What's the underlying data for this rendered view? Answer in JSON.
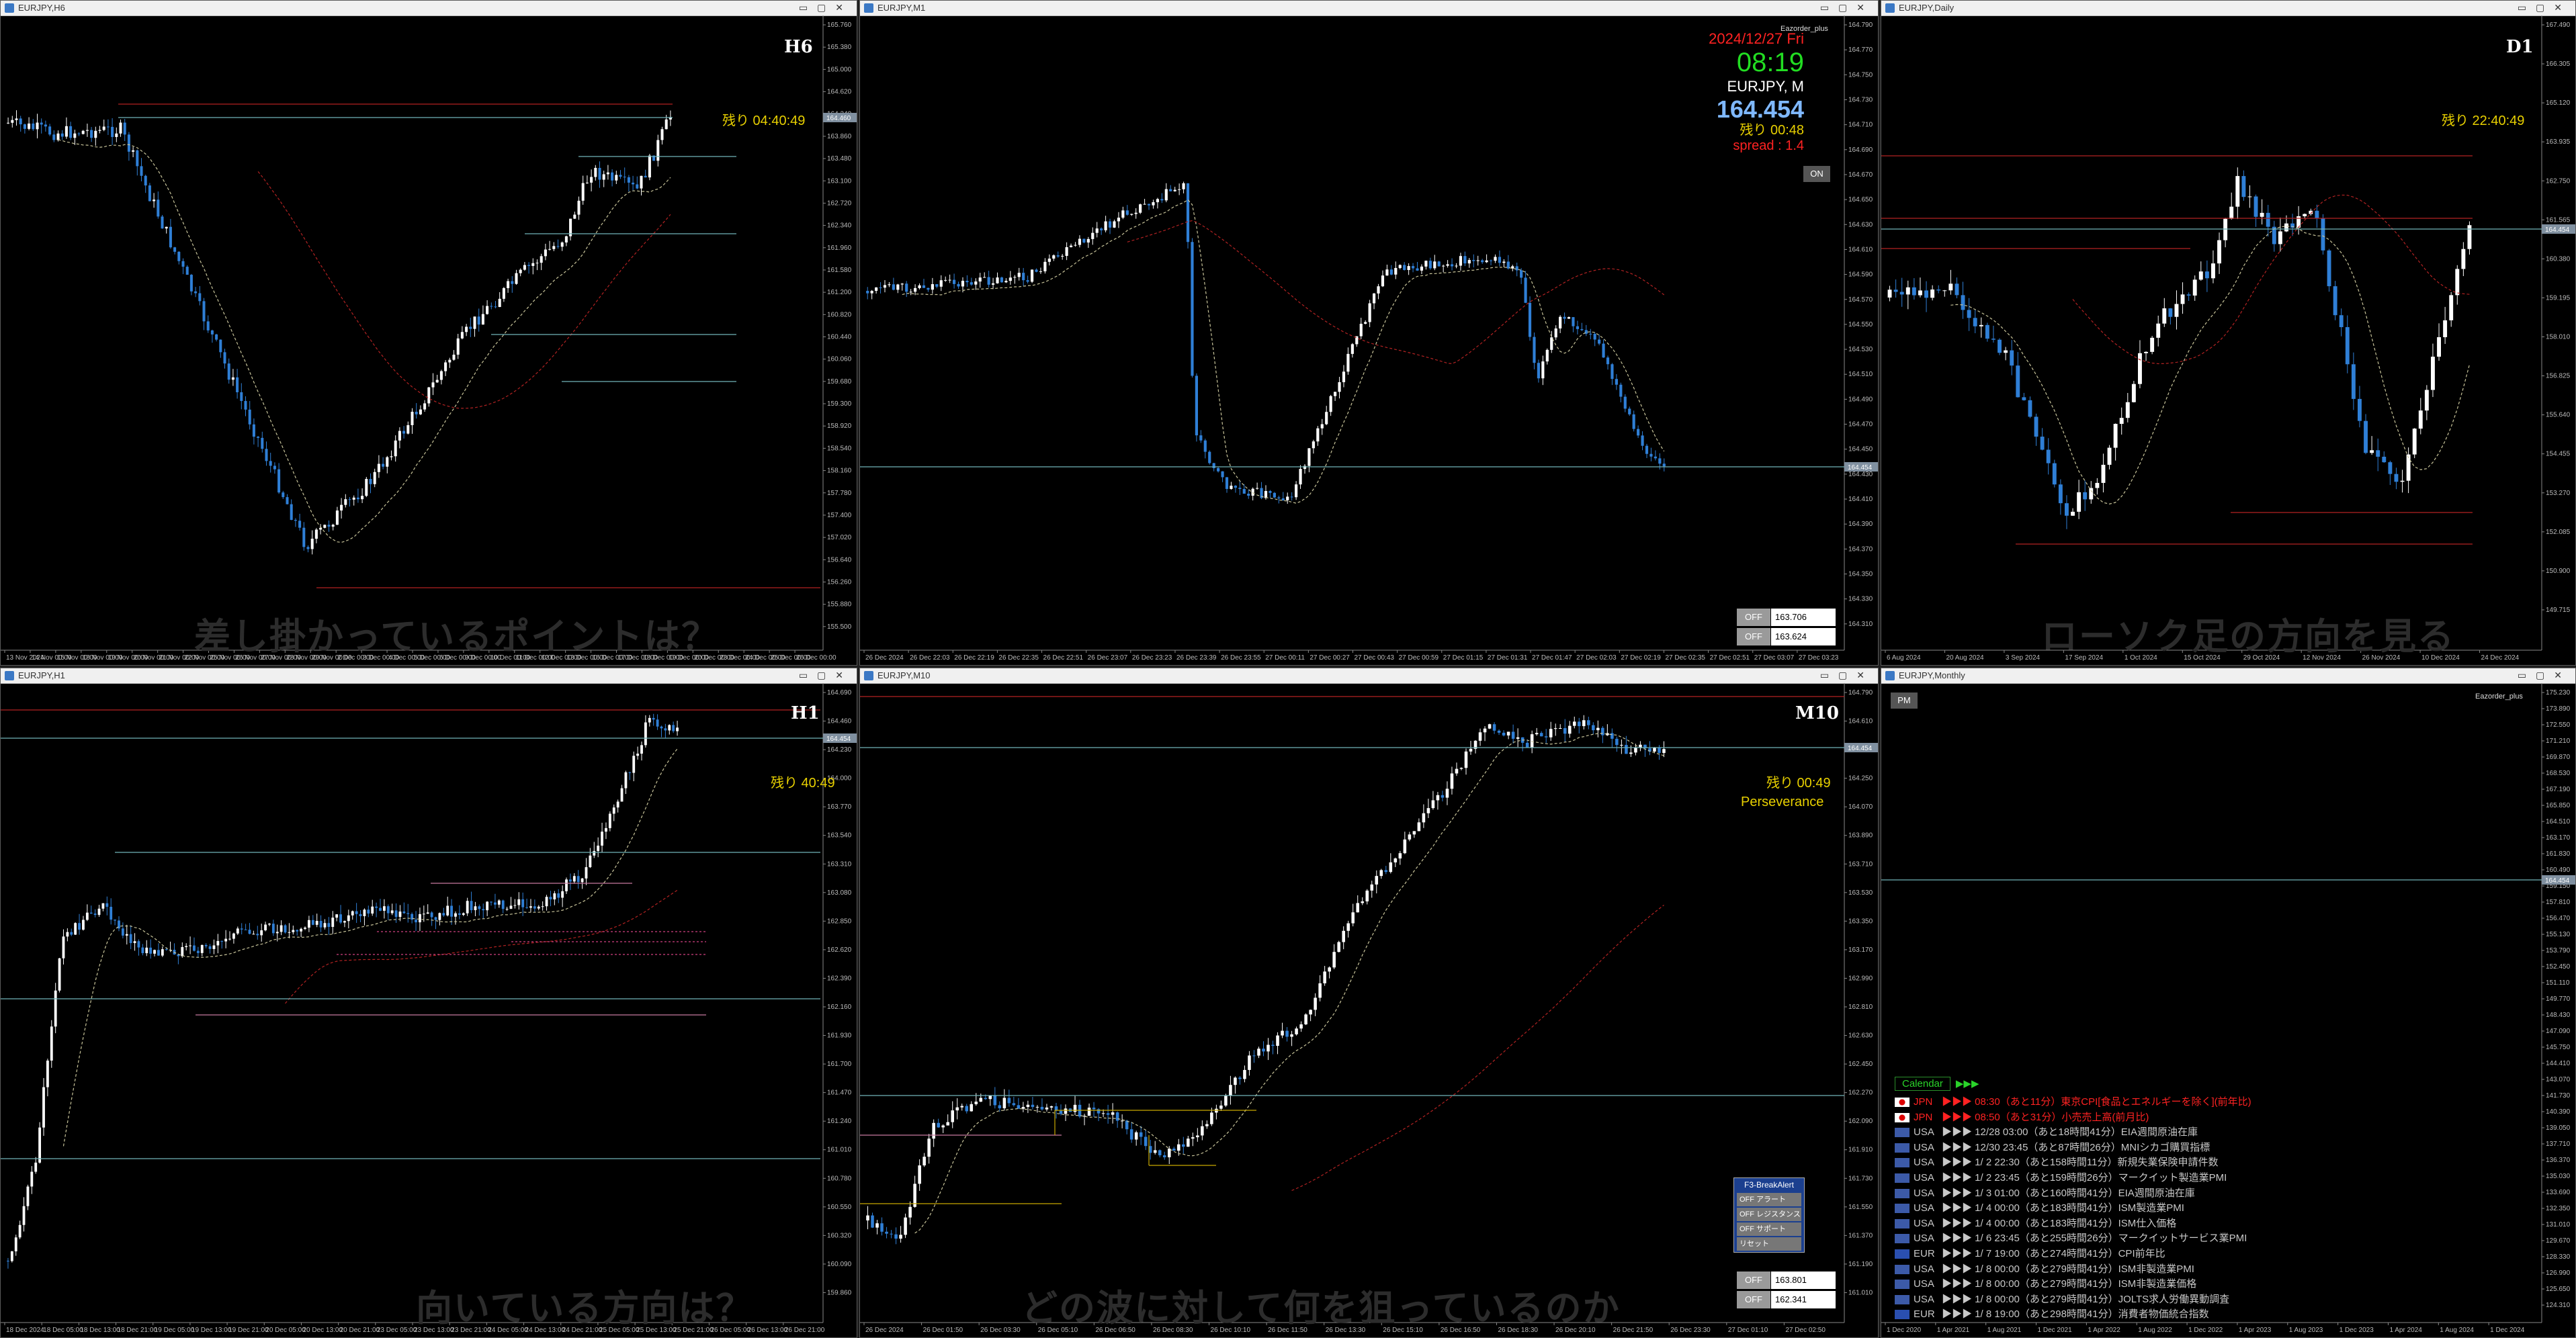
{
  "windows": {
    "h6": {
      "title": "EURJPY,H6",
      "timeframe": "H6",
      "remaining": "残り 04:40:49",
      "watermark": "差し掛かっているポイントは？",
      "price_tags": [
        "164.460"
      ],
      "axis_prices": [
        "165.760",
        "165.380",
        "165.000",
        "164.620",
        "164.240",
        "163.860",
        "163.480",
        "163.100",
        "162.720",
        "162.340",
        "161.960",
        "161.580",
        "161.200",
        "160.820",
        "160.440",
        "160.060",
        "159.680",
        "159.300",
        "158.920",
        "158.540",
        "158.160",
        "157.780",
        "157.400",
        "157.020",
        "156.640",
        "156.260",
        "155.880",
        "155.500"
      ],
      "axis_times": [
        "13 Nov 2024",
        "14 Nov 00:00",
        "15 Nov 00:00",
        "18 Nov 00:00",
        "19 Nov 00:00",
        "20 Nov 00:00",
        "21 Nov 00:00",
        "22 Nov 00:00",
        "25 Nov 00:00",
        "26 Nov 00:00",
        "27 Nov 00:00",
        "28 Nov 00:00",
        "29 Nov 00:00",
        "2 Dec 00:00",
        "3 Dec 00:00",
        "4 Dec 00:00",
        "5 Dec 00:00",
        "6 Dec 00:00",
        "9 Dec 00:00",
        "10 Dec 00:00",
        "11 Dec 00:00",
        "12 Dec 00:00",
        "13 Dec 00:00",
        "16 Dec 00:00",
        "17 Dec 00:00",
        "18 Dec 00:00",
        "19 Dec 00:00",
        "20 Dec 00:00",
        "23 Dec 00:00",
        "24 Dec 00:00",
        "25 Dec 00:00",
        "26 Dec 00:00"
      ]
    },
    "m1": {
      "title": "EURJPY,M1",
      "brand": "Eazorder_plus",
      "date": "2024/12/27 Fri",
      "time": "08:19",
      "symbol": "EURJPY, M",
      "price": "164.454",
      "remaining": "残り 00:48",
      "spread": "spread : 1.4",
      "on_label": "ON",
      "off_label": "OFF",
      "levels": [
        "163.706",
        "163.624"
      ],
      "price_tags": [
        "164.454"
      ],
      "axis_prices": [
        "164.790",
        "164.770",
        "164.750",
        "164.730",
        "164.710",
        "164.690",
        "164.670",
        "164.650",
        "164.630",
        "164.610",
        "164.590",
        "164.570",
        "164.550",
        "164.530",
        "164.510",
        "164.490",
        "164.470",
        "164.450",
        "164.430",
        "164.410",
        "164.390",
        "164.370",
        "164.350",
        "164.330",
        "164.310"
      ],
      "axis_times": [
        "26 Dec 2024",
        "26 Dec 22:03",
        "26 Dec 22:19",
        "26 Dec 22:35",
        "26 Dec 22:51",
        "26 Dec 23:07",
        "26 Dec 23:23",
        "26 Dec 23:39",
        "26 Dec 23:55",
        "27 Dec 00:11",
        "27 Dec 00:27",
        "27 Dec 00:43",
        "27 Dec 00:59",
        "27 Dec 01:15",
        "27 Dec 01:31",
        "27 Dec 01:47",
        "27 Dec 02:03",
        "27 Dec 02:19",
        "27 Dec 02:35",
        "27 Dec 02:51",
        "27 Dec 03:07",
        "27 Dec 03:23"
      ]
    },
    "d1": {
      "title": "EURJPY,Daily",
      "timeframe": "D1",
      "remaining": "残り 22:40:49",
      "watermark": "ローソク足の方向を見る",
      "price_tags": [
        "164.454"
      ],
      "axis_prices": [
        "167.490",
        "166.305",
        "165.120",
        "163.935",
        "162.750",
        "161.565",
        "160.380",
        "159.195",
        "158.010",
        "156.825",
        "155.640",
        "154.455",
        "153.270",
        "152.085",
        "150.900",
        "149.715"
      ],
      "axis_times": [
        "6 Aug 2024",
        "20 Aug 2024",
        "3 Sep 2024",
        "17 Sep 2024",
        "1 Oct 2024",
        "15 Oct 2024",
        "29 Oct 2024",
        "12 Nov 2024",
        "26 Nov 2024",
        "10 Dec 2024",
        "24 Dec 2024"
      ]
    },
    "h1": {
      "title": "EURJPY,H1",
      "timeframe": "H1",
      "remaining": "残り 40:49",
      "watermark": "向いている方向は？",
      "price_tags": [
        "164.454"
      ],
      "axis_prices": [
        "164.690",
        "164.460",
        "164.230",
        "164.000",
        "163.770",
        "163.540",
        "163.310",
        "163.080",
        "162.850",
        "162.620",
        "162.390",
        "162.160",
        "161.930",
        "161.700",
        "161.470",
        "161.240",
        "161.010",
        "160.780",
        "160.550",
        "160.320",
        "160.090",
        "159.860"
      ],
      "axis_times": [
        "18 Dec 2024",
        "18 Dec 05:00",
        "18 Dec 13:00",
        "18 Dec 21:00",
        "19 Dec 05:00",
        "19 Dec 13:00",
        "19 Dec 21:00",
        "20 Dec 05:00",
        "20 Dec 13:00",
        "20 Dec 21:00",
        "23 Dec 05:00",
        "23 Dec 13:00",
        "23 Dec 21:00",
        "24 Dec 05:00",
        "24 Dec 13:00",
        "24 Dec 21:00",
        "25 Dec 05:00",
        "25 Dec 13:00",
        "25 Dec 21:00",
        "26 Dec 05:00",
        "26 Dec 13:00",
        "26 Dec 21:00"
      ]
    },
    "m10": {
      "title": "EURJPY,M10",
      "timeframe": "M10",
      "remaining": "残り 00:49",
      "strategy": "Perseverance",
      "watermark": "どの波に対して何を狙っているのか",
      "alert": {
        "header": "F3-BreakAlert",
        "rows": [
          "OFF アラート",
          "OFF レジスタンス",
          "OFF サポート",
          "リセット"
        ]
      },
      "off_label": "OFF",
      "levels": [
        "163.801",
        "162.341"
      ],
      "price_tags": [
        "164.454"
      ],
      "axis_prices": [
        "164.790",
        "164.610",
        "164.430",
        "164.250",
        "164.070",
        "163.890",
        "163.710",
        "163.530",
        "163.350",
        "163.170",
        "162.990",
        "162.810",
        "162.630",
        "162.450",
        "162.270",
        "162.090",
        "161.910",
        "161.730",
        "161.550",
        "161.370",
        "161.190",
        "161.010"
      ],
      "axis_times": [
        "26 Dec 2024",
        "26 Dec 01:50",
        "26 Dec 03:30",
        "26 Dec 05:10",
        "26 Dec 06:50",
        "26 Dec 08:30",
        "26 Dec 10:10",
        "26 Dec 11:50",
        "26 Dec 13:30",
        "26 Dec 15:10",
        "26 Dec 16:50",
        "26 Dec 18:30",
        "26 Dec 20:10",
        "26 Dec 21:50",
        "26 Dec 23:30",
        "27 Dec 01:10",
        "27 Dec 02:50"
      ]
    },
    "mn": {
      "title": "EURJPY,Monthly",
      "pm_label": "PM",
      "brand": "Eazorder_plus",
      "calendar_label": "Calendar",
      "calendar_arrows": "▶▶▶",
      "events": [
        {
          "country": "JPN",
          "text": "▶▶▶ 08:30（あと11分）東京CPI[食品とエネルギーを除く](前年比)",
          "highlight": true,
          "flag": "#ffffff"
        },
        {
          "country": "JPN",
          "text": "▶▶▶ 08:50（あと31分）小売売上高(前月比)",
          "highlight": true,
          "flag": "#ffffff"
        },
        {
          "country": "USA",
          "text": "▶▶▶ 12/28 03:00（あと18時間41分）EIA週間原油在庫",
          "highlight": false,
          "flag": "#3c5aa8"
        },
        {
          "country": "USA",
          "text": "▶▶▶ 12/30 23:45（あと87時間26分）MNIシカゴ購買指標",
          "highlight": false,
          "flag": "#3c5aa8"
        },
        {
          "country": "USA",
          "text": "▶▶▶ 1/ 2 22:30（あと158時間11分）新規失業保険申請件数",
          "highlight": false,
          "flag": "#3c5aa8"
        },
        {
          "country": "USA",
          "text": "▶▶▶ 1/ 2 23:45（あと159時間26分）マークイット製造業PMI",
          "highlight": false,
          "flag": "#3c5aa8"
        },
        {
          "country": "USA",
          "text": "▶▶▶ 1/ 3 01:00（あと160時間41分）EIA週間原油在庫",
          "highlight": false,
          "flag": "#3c5aa8"
        },
        {
          "country": "USA",
          "text": "▶▶▶ 1/ 4 00:00（あと183時間41分）ISM製造業PMI",
          "highlight": false,
          "flag": "#3c5aa8"
        },
        {
          "country": "USA",
          "text": "▶▶▶ 1/ 4 00:00（あと183時間41分）ISM仕入価格",
          "highlight": false,
          "flag": "#3c5aa8"
        },
        {
          "country": "USA",
          "text": "▶▶▶ 1/ 6 23:45（あと255時間26分）マークイットサービス業PMI",
          "highlight": false,
          "flag": "#3c5aa8"
        },
        {
          "country": "EUR",
          "text": "▶▶▶ 1/ 7 19:00（あと274時間41分）CPI前年比",
          "highlight": false,
          "flag": "#2a4fb0"
        },
        {
          "country": "USA",
          "text": "▶▶▶ 1/ 8 00:00（あと279時間41分）ISM非製造業PMI",
          "highlight": false,
          "flag": "#3c5aa8"
        },
        {
          "country": "USA",
          "text": "▶▶▶ 1/ 8 00:00（あと279時間41分）ISM非製造業価格",
          "highlight": false,
          "flag": "#3c5aa8"
        },
        {
          "country": "USA",
          "text": "▶▶▶ 1/ 8 00:00（あと279時間41分）JOLTS求人労働異動調査",
          "highlight": false,
          "flag": "#3c5aa8"
        },
        {
          "country": "EUR",
          "text": "▶▶▶ 1/ 8 19:00（あと298時間41分）消費者物価統合指数",
          "highlight": false,
          "flag": "#2a4fb0"
        }
      ],
      "price_tags": [
        "164.454"
      ],
      "axis_prices": [
        "175.230",
        "173.890",
        "172.550",
        "171.210",
        "169.870",
        "168.530",
        "167.190",
        "165.850",
        "164.510",
        "163.170",
        "161.830",
        "160.490",
        "159.150",
        "157.810",
        "156.470",
        "155.130",
        "153.790",
        "152.450",
        "151.110",
        "149.770",
        "148.430",
        "147.090",
        "145.750",
        "144.410",
        "143.070",
        "141.730",
        "140.390",
        "139.050",
        "137.710",
        "136.370",
        "135.030",
        "133.690",
        "132.350",
        "131.010",
        "129.670",
        "128.330",
        "126.990",
        "125.650",
        "124.310"
      ],
      "axis_times": [
        "1 Dec 2020",
        "1 Apr 2021",
        "1 Aug 2021",
        "1 Dec 2021",
        "1 Apr 2022",
        "1 Aug 2022",
        "1 Dec 2022",
        "1 Apr 2023",
        "1 Aug 2023",
        "1 Dec 2023",
        "1 Apr 2024",
        "1 Aug 2024",
        "1 Dec 2024"
      ]
    }
  },
  "colors": {
    "bull": "#ffffff",
    "bear": "#2f7fd6",
    "ma_slow": "#b22222",
    "ma_fast": "#c8c49a",
    "level_red": "#b22222",
    "level_cyan": "#6fb3b8",
    "remaining": "#e8d000",
    "spread": "#ff2222",
    "clock": "#22dd22",
    "price": "#7fb8ff"
  }
}
